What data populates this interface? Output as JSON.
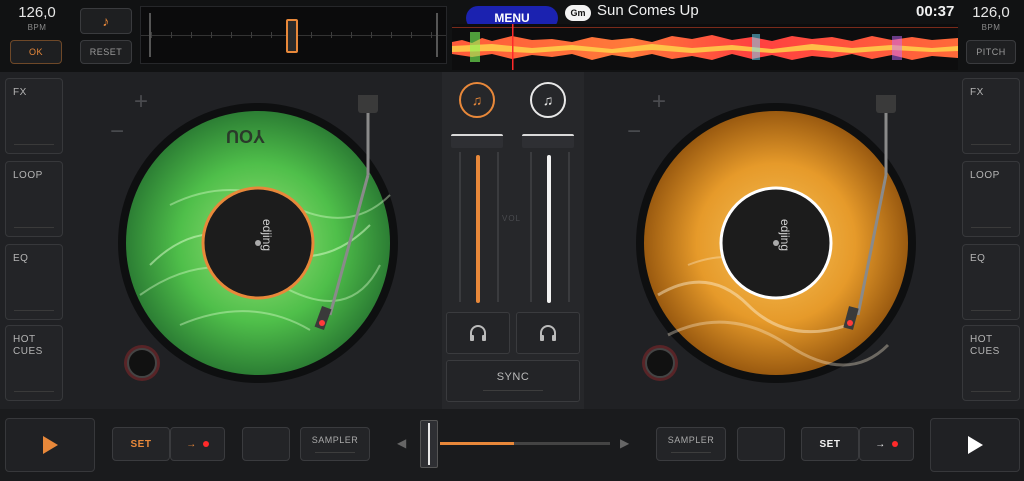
{
  "topbar": {
    "left_bpm": "126,0",
    "left_bpm_label": "BPM",
    "ok_label": "OK",
    "note_icon_char": "♪",
    "reset_label": "RESET",
    "menu_label": "MENU",
    "key_badge": "Gm",
    "track_title": "Sun Comes Up",
    "track_time": "00:37",
    "right_bpm": "126,0",
    "right_bpm_label": "BPM",
    "pitch_label": "PITCH"
  },
  "left_deck": {
    "side_buttons": [
      "FX",
      "LOOP",
      "EQ",
      "HOT\nCUES"
    ],
    "accent": "#e8883a",
    "record_label_brand": "edjing",
    "record_text": "YOU"
  },
  "right_deck": {
    "side_buttons": [
      "FX",
      "LOOP",
      "EQ",
      "HOT\nCUES"
    ],
    "accent": "#ffffff",
    "record_label_brand": "edjing"
  },
  "mixer": {
    "vol_label": "VOL",
    "sync_label": "SYNC",
    "left_deck_icon": "music-note-plus-icon",
    "right_deck_icon": "music-note-plus-icon",
    "headphone_icon": "headphones-icon"
  },
  "bottombar": {
    "left_set_label": "SET",
    "left_sampler_label": "SAMPLER",
    "right_sampler_label": "SAMPLER",
    "right_set_label": "SET",
    "crossfader_position": 0.0
  },
  "colors": {
    "accent_orange": "#e8883a",
    "menu_blue": "#1b22b0",
    "record_green": "#4fbf4a",
    "record_orange": "#e69a2a"
  }
}
